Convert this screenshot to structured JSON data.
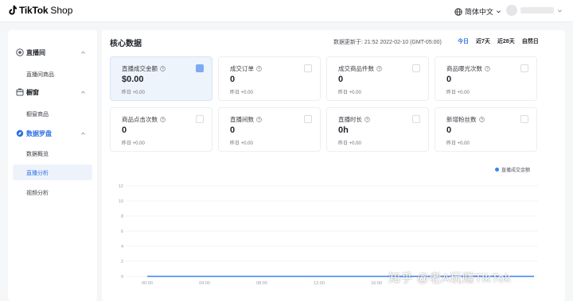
{
  "header": {
    "brand": "TikTok",
    "shop": "Shop",
    "language": "简体中文"
  },
  "sidebar": {
    "groups": [
      {
        "label": "直播间",
        "icon": "live-icon",
        "items": [
          "直播间商品"
        ]
      },
      {
        "label": "橱窗",
        "icon": "showcase-icon",
        "items": [
          "橱窗商品"
        ]
      },
      {
        "label": "数据罗盘",
        "icon": "compass-icon",
        "items": [
          "数据概览",
          "直播分析",
          "视频分析"
        ],
        "active_item": "直播分析"
      }
    ]
  },
  "main": {
    "title": "核心数据",
    "update_time": "数据更新于: 21:52 2022-02-10 (GMT-05:00)",
    "ranges": [
      "今日",
      "近7天",
      "近28天",
      "自然日"
    ],
    "active_range": "今日",
    "cards": [
      {
        "label": "直播成交金额",
        "value": "$0.00",
        "sub": "昨日 +0.00",
        "selected": true
      },
      {
        "label": "成交订单",
        "value": "0",
        "sub": "昨日 +0.00",
        "selected": false
      },
      {
        "label": "成交商品件数",
        "value": "0",
        "sub": "昨日 +0.00",
        "selected": false
      },
      {
        "label": "商品曝光次数",
        "value": "0",
        "sub": "昨日 +0.00",
        "selected": false
      },
      {
        "label": "商品点击次数",
        "value": "0",
        "sub": "昨日 +0.00",
        "selected": false
      },
      {
        "label": "直播间数",
        "value": "0",
        "sub": "昨日 +0.00",
        "selected": false
      },
      {
        "label": "直播时长",
        "value": "0h",
        "sub": "昨日 +0.00",
        "selected": false
      },
      {
        "label": "新增粉丝数",
        "value": "0",
        "sub": "昨日 +0.00",
        "selected": false
      }
    ],
    "legend": "直播成交金额"
  },
  "chart_data": {
    "type": "line",
    "x": [
      "00:00",
      "04:00",
      "08:00",
      "12:00",
      "16:00"
    ],
    "series": [
      {
        "name": "直播成交金额",
        "values": [
          0,
          0,
          0,
          0,
          0
        ]
      }
    ],
    "y_ticks": [
      0,
      2,
      4,
      6,
      8,
      10,
      12
    ],
    "ylim": [
      0,
      12
    ],
    "grid": true,
    "legend_position": "top-right",
    "color": "#3b82f6"
  },
  "watermark": "知乎 @老A玩赚TikTok"
}
